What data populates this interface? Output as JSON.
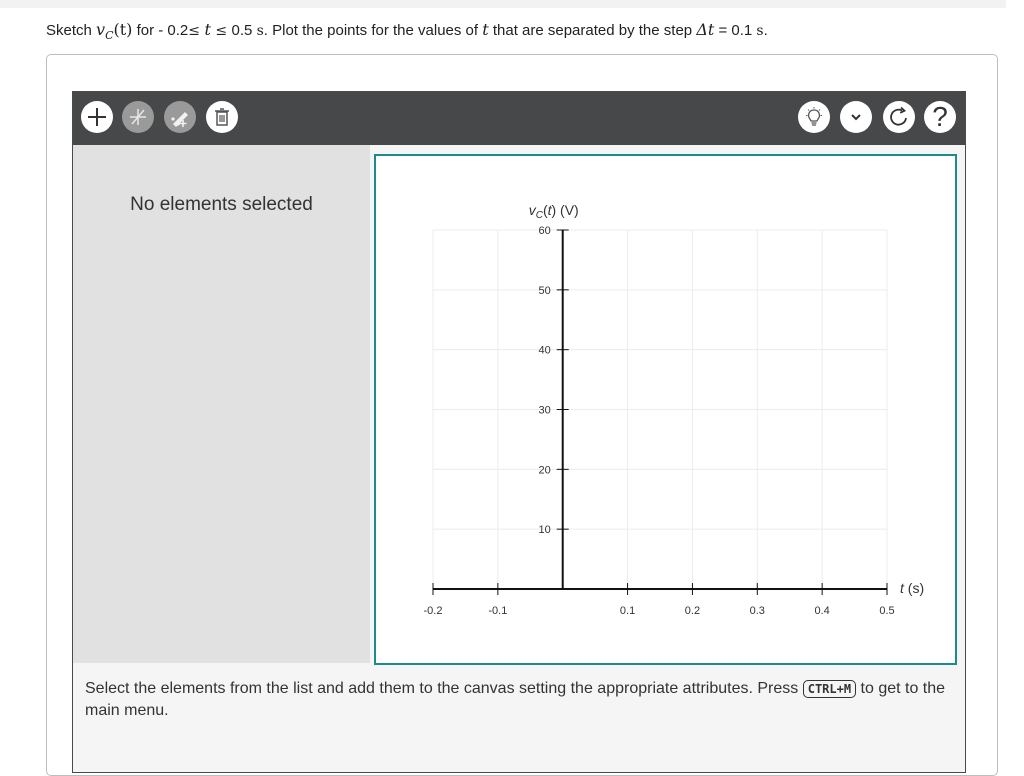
{
  "question": {
    "prefix": "Sketch ",
    "vc": "v",
    "vc_sub": "C",
    "vc_arg": "(t)",
    "mid1": " for - 0.2",
    "le1": "≤ ",
    "t1": "t",
    "le2": " ≤ ",
    "mid2": "0.5 ",
    "s1": "s",
    "mid3": ". Plot the points for the values of ",
    "t2": "t",
    "mid4": " that are separated by the step ",
    "delta": "Δt",
    "mid5": " = 0.1 ",
    "s2": "s",
    "mid6": "."
  },
  "toolbar": {
    "add_icon": "plus-icon",
    "line_icon": "line-tool-icon",
    "point_icon": "add-point-icon",
    "delete_icon": "trash-icon",
    "hint_icon": "lightbulb-icon",
    "menu_icon": "chevron-down-icon",
    "reset_icon": "rotate-icon",
    "help_icon": "question-icon",
    "help_glyph": "?"
  },
  "sidepanel": {
    "message": "No elements selected"
  },
  "footer": {
    "text_before": "Select the elements from the list and add them to the canvas setting the appropriate attributes. Press ",
    "shortcut": "CTRL+M",
    "text_after": " to get to the main menu."
  },
  "chart_data": {
    "type": "scatter",
    "xlabel": "t (s)",
    "ylabel": "vC(t) (V)",
    "xlim": [
      -0.2,
      0.5
    ],
    "ylim": [
      0,
      60
    ],
    "x_ticks": [
      "-0.2",
      "-0.1",
      "0.1",
      "0.2",
      "0.3",
      "0.4",
      "0.5"
    ],
    "y_ticks": [
      "10",
      "20",
      "30",
      "40",
      "50",
      "60"
    ],
    "grid": true,
    "points": []
  },
  "colors": {
    "toolbar_bg": "#47484a",
    "canvas_border": "#1f8a8a",
    "side_bg": "#e1e1e1"
  }
}
